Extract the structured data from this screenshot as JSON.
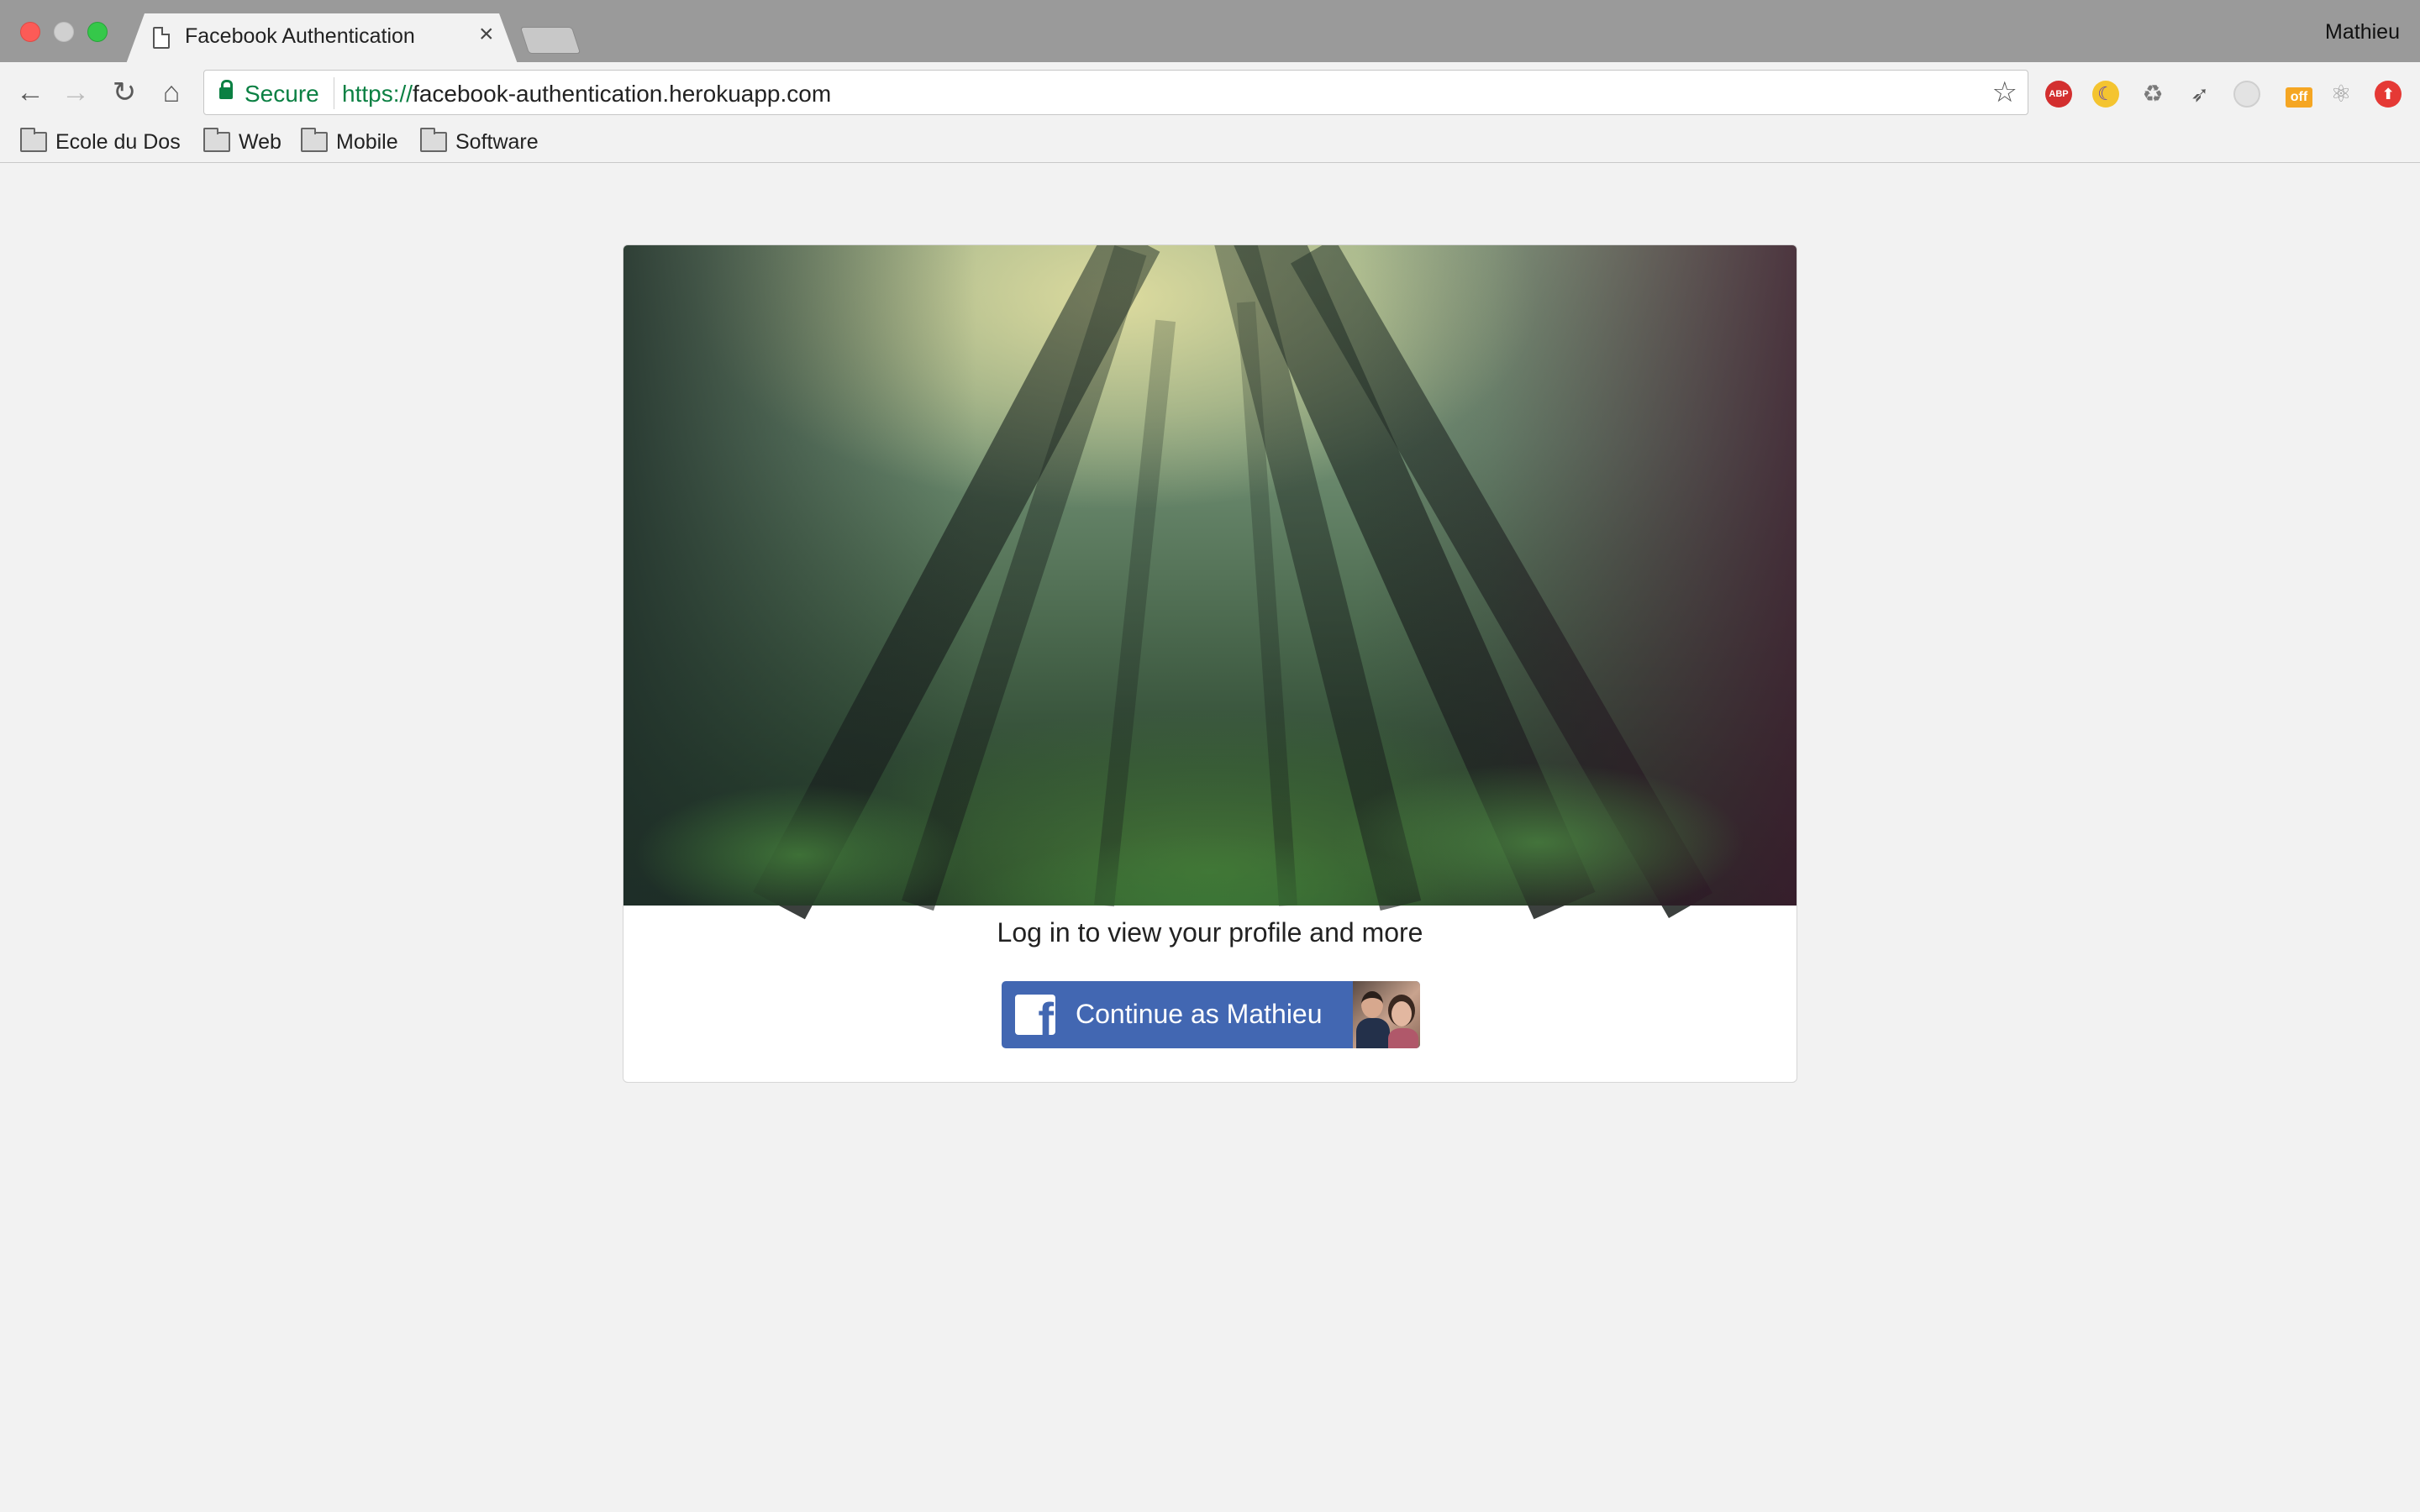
{
  "window": {
    "user": "Mathieu"
  },
  "tab": {
    "title": "Facebook Authentication",
    "close": "×"
  },
  "toolbar": {
    "secure_label": "Secure",
    "url_scheme": "https://",
    "url_rest": "facebook-authentication.herokuapp.com",
    "back": "←",
    "forward": "→",
    "reload": "↻",
    "home": "⌂",
    "star": "☆",
    "extensions": [
      {
        "name": "adblock-plus-icon",
        "text": "ABP",
        "color": "#d32f2f"
      },
      {
        "name": "moon-extension-icon",
        "text": "☾",
        "color": "#f4c430"
      },
      {
        "name": "recycle-extension-icon",
        "text": "♻",
        "color": "#9e9e9e"
      },
      {
        "name": "arrow-extension-icon",
        "text": "➶",
        "color": "#9e9e9e"
      },
      {
        "name": "grey-circle-extension-icon",
        "text": "",
        "color": "#d8d8d8"
      },
      {
        "name": "off-extension-icon",
        "text": "off",
        "color": "#f5a623"
      },
      {
        "name": "react-devtools-icon",
        "text": "⚛",
        "color": "#bdbdbd"
      },
      {
        "name": "upload-extension-icon",
        "text": "⬆",
        "color": "#e53935"
      }
    ]
  },
  "bookmarks": [
    {
      "label": "Ecole du Dos"
    },
    {
      "label": "Web"
    },
    {
      "label": "Mobile"
    },
    {
      "label": "Software"
    }
  ],
  "card": {
    "prompt": "Log in to view your profile and more",
    "button_label": "Continue as Mathieu",
    "fb_letter": "f"
  }
}
